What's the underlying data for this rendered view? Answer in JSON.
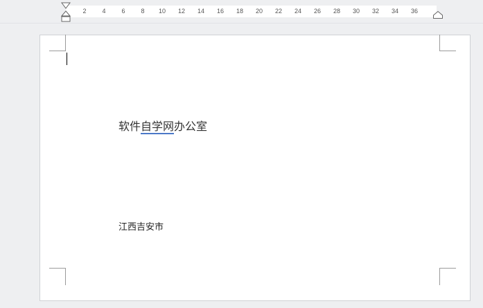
{
  "ruler": {
    "ticks": [
      "2",
      "4",
      "6",
      "8",
      "10",
      "12",
      "14",
      "16",
      "18",
      "20",
      "22",
      "24",
      "26",
      "28",
      "30",
      "32",
      "34",
      "36"
    ]
  },
  "document": {
    "line1": {
      "before": "软件",
      "marked": "自学网",
      "after": "办公室"
    },
    "line2": "江西吉安市"
  },
  "colors": {
    "background": "#eeeff1",
    "page": "#ffffff",
    "spell_underline": "#4b78c8",
    "corner_marks": "#9a9a9a"
  }
}
